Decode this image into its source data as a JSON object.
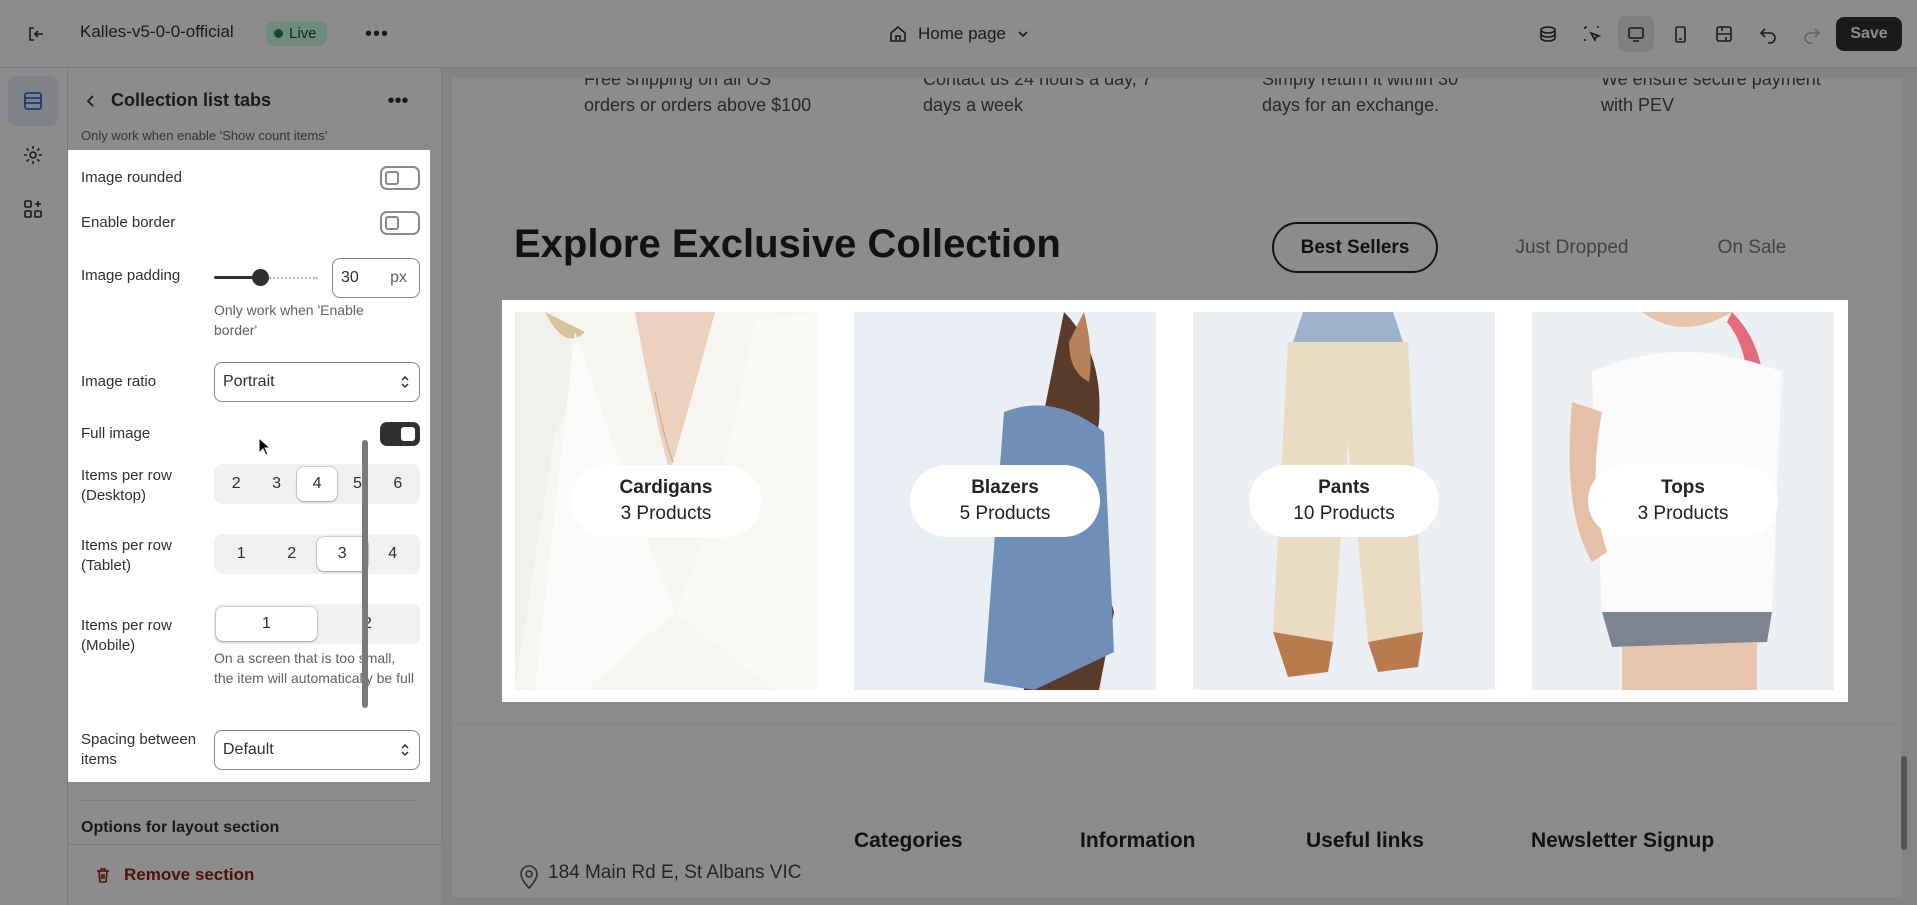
{
  "topbar": {
    "store_name": "Kalles-v5-0-0-official",
    "live_badge": "Live",
    "page_selector": "Home page",
    "save_label": "Save"
  },
  "panel": {
    "title": "Collection list tabs",
    "note_top": "Only work when enable 'Show count items'",
    "image_rounded": {
      "label": "Image rounded",
      "on": false
    },
    "enable_border": {
      "label": "Enable border",
      "on": false
    },
    "image_padding": {
      "label": "Image padding",
      "value": "30",
      "unit": "px",
      "help": "Only work when 'Enable border'",
      "level": 0.3
    },
    "image_ratio": {
      "label": "Image ratio",
      "value": "Portrait"
    },
    "full_image": {
      "label": "Full image",
      "on": true
    },
    "items_desktop": {
      "label": "Items per row (Desktop)",
      "options": [
        "2",
        "3",
        "4",
        "5",
        "6"
      ],
      "selected": "4"
    },
    "items_tablet": {
      "label": "Items per row (Tablet)",
      "options": [
        "1",
        "2",
        "3",
        "4"
      ],
      "selected": "3"
    },
    "items_mobile": {
      "label": "Items per row (Mobile)",
      "options": [
        "1",
        "2"
      ],
      "selected": "1",
      "help": "On a screen that is too small, the item will automatically be full"
    },
    "spacing": {
      "label": "Spacing between items",
      "value": "Default"
    },
    "options_heading": "Options for layout section",
    "remove_label": "Remove section"
  },
  "preview": {
    "features": [
      "Free shipping on all US orders or orders above $100",
      "Contact us 24 hours a day, 7 days a week",
      "Simply return it within 30 days for an exchange.",
      "We ensure secure payment with PEV"
    ],
    "heading": "Explore Exclusive Collection",
    "tabs": [
      "Best Sellers",
      "Just Dropped",
      "On Sale"
    ],
    "active_tab": "Best Sellers",
    "collections": [
      {
        "name": "Cardigans",
        "count": "3 Products"
      },
      {
        "name": "Blazers",
        "count": "5 Products"
      },
      {
        "name": "Pants",
        "count": "10 Products"
      },
      {
        "name": "Tops",
        "count": "3 Products"
      }
    ],
    "footer_headings": [
      "Categories",
      "Information",
      "Useful links",
      "Newsletter Signup"
    ],
    "address": "184 Main Rd E, St Albans VIC"
  },
  "colors": {
    "accent_dark": "#303030",
    "live_bg": "#cdfee1",
    "remove_red": "#8e1f0b"
  }
}
